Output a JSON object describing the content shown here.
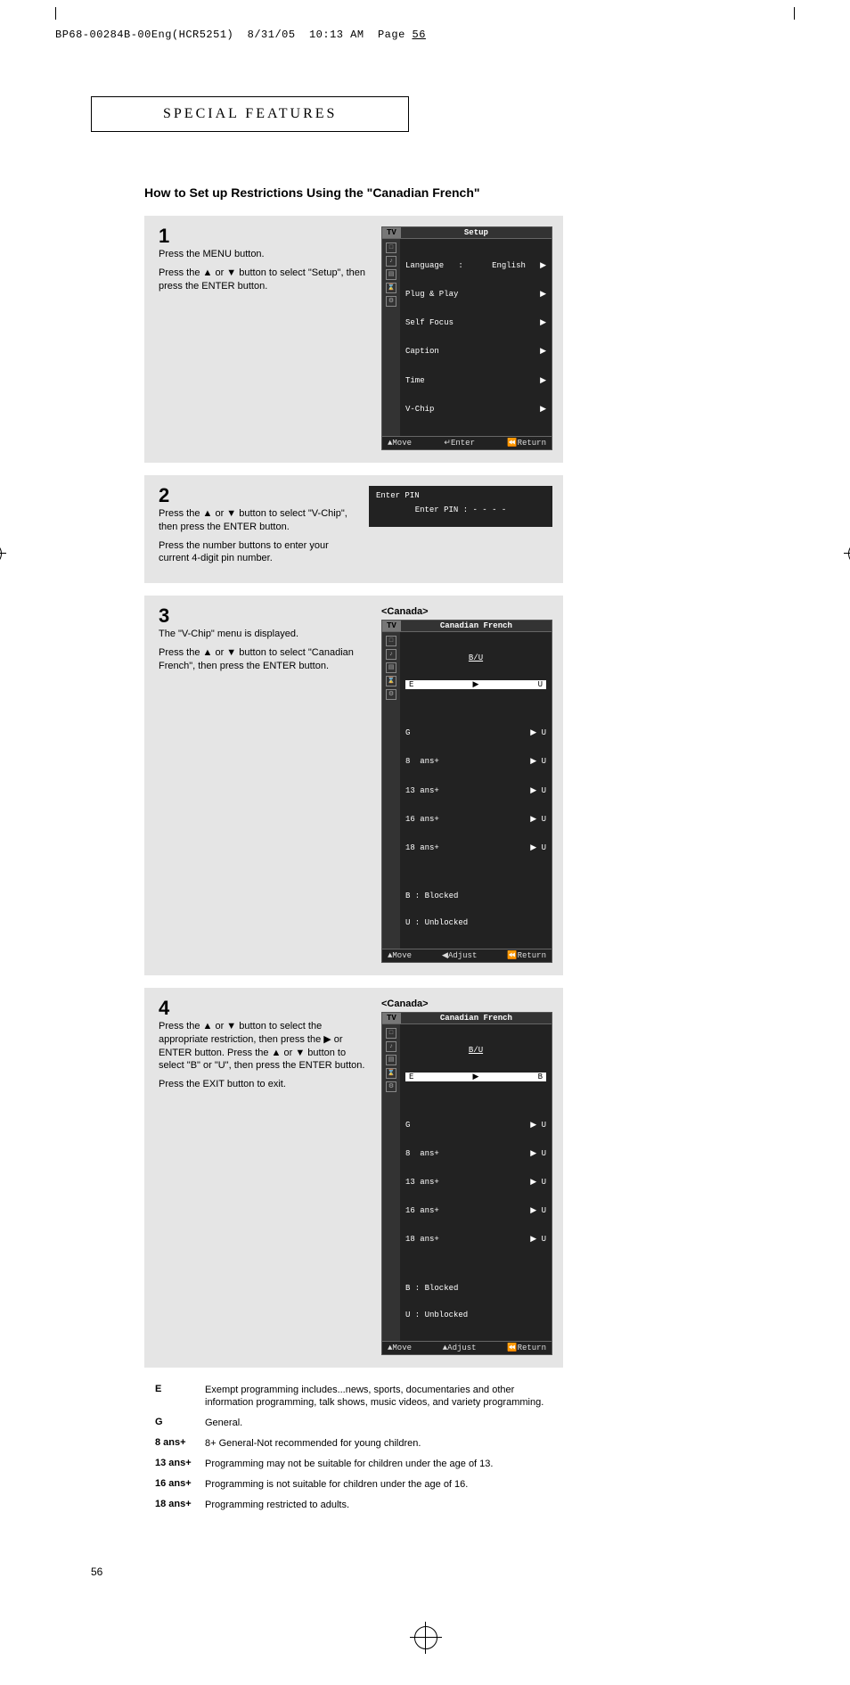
{
  "slug": {
    "file": "BP68-00284B-00Eng(HCR5251)",
    "date": "8/31/05",
    "time": "10:13 AM",
    "page_prefix": "Page ",
    "page": "56"
  },
  "section_header": "SPECIAL FEATURES",
  "title": "How to Set up Restrictions Using the \"Canadian French\"",
  "steps": {
    "s1": {
      "num": "1",
      "lines": [
        "Press the MENU button.",
        "Press the ▲ or ▼ button to select \"Setup\", then press the ENTER button."
      ]
    },
    "s2": {
      "num": "2",
      "lines": [
        "Press the ▲ or ▼ button to select \"V-Chip\", then press the ENTER button.",
        "Press the number buttons to enter your current 4-digit pin number."
      ]
    },
    "s3": {
      "num": "3",
      "lines": [
        "The \"V-Chip\" menu is displayed.",
        "Press the ▲ or ▼ button to select \"Canadian French\", then press the ENTER button."
      ]
    },
    "s4": {
      "num": "4",
      "lines": [
        "Press the ▲ or ▼ button to select the appropriate restriction, then press  the ▶ or ENTER button. Press the ▲ or ▼ button to select \"B\" or \"U\", then press the ENTER button.",
        "Press the EXIT button to exit."
      ]
    }
  },
  "osd1": {
    "tab": "TV",
    "title": "Setup",
    "items": [
      {
        "l": "Language   :",
        "r": "English   ▶"
      },
      {
        "l": "Plug & Play",
        "r": "▶"
      },
      {
        "l": "Self Focus",
        "r": "▶"
      },
      {
        "l": "Caption",
        "r": "▶"
      },
      {
        "l": "Time",
        "r": "▶"
      },
      {
        "l": "V-Chip",
        "r": "▶"
      }
    ],
    "footer": {
      "a": "▲Move",
      "b": "↵Enter",
      "c": "⏪Return"
    }
  },
  "osd_pin": {
    "title": "Enter PIN",
    "line": "Enter PIN      : - - - -"
  },
  "canada_label": "<Canada>",
  "osd3": {
    "tab": "TV",
    "title": "Canadian French",
    "buhead": "B/U",
    "hl": {
      "l": "E",
      "mid": "▶",
      "r": "U"
    },
    "rows": [
      {
        "l": "G",
        "r": "U"
      },
      {
        "l": "8  ans+",
        "r": "U"
      },
      {
        "l": "13 ans+",
        "r": "U"
      },
      {
        "l": "16 ans+",
        "r": "U"
      },
      {
        "l": "18 ans+",
        "r": "U"
      }
    ],
    "legend": [
      "B : Blocked",
      "U : Unblocked"
    ],
    "footer": {
      "a": "▲Move",
      "b": "◀Adjust",
      "c": "⏪Return"
    }
  },
  "osd4": {
    "tab": "TV",
    "title": "Canadian French",
    "buhead": "B/U",
    "hl": {
      "l": "E",
      "mid": "▶",
      "r": "B"
    },
    "rows": [
      {
        "l": "G",
        "r": "U"
      },
      {
        "l": "8  ans+",
        "r": "U"
      },
      {
        "l": "13 ans+",
        "r": "U"
      },
      {
        "l": "16 ans+",
        "r": "U"
      },
      {
        "l": "18 ans+",
        "r": "U"
      }
    ],
    "legend": [
      "B : Blocked",
      "U : Unblocked"
    ],
    "footer": {
      "a": "▲Move",
      "b": "▲Adjust",
      "c": "⏪Return"
    }
  },
  "ratings": [
    {
      "key": "E",
      "desc": "Exempt programming includes...news, sports, documentaries and other information programming, talk shows, music videos, and  variety programming."
    },
    {
      "key": "G",
      "desc": "General."
    },
    {
      "key": "8  ans+",
      "desc": "8+ General-Not recommended for young children."
    },
    {
      "key": "13 ans+",
      "desc": "Programming may not be suitable for children under the age of 13."
    },
    {
      "key": "16 ans+",
      "desc": "Programming is not suitable for children under the age of 16."
    },
    {
      "key": "18 ans+",
      "desc": "Programming restricted to adults."
    }
  ],
  "page_number": "56"
}
